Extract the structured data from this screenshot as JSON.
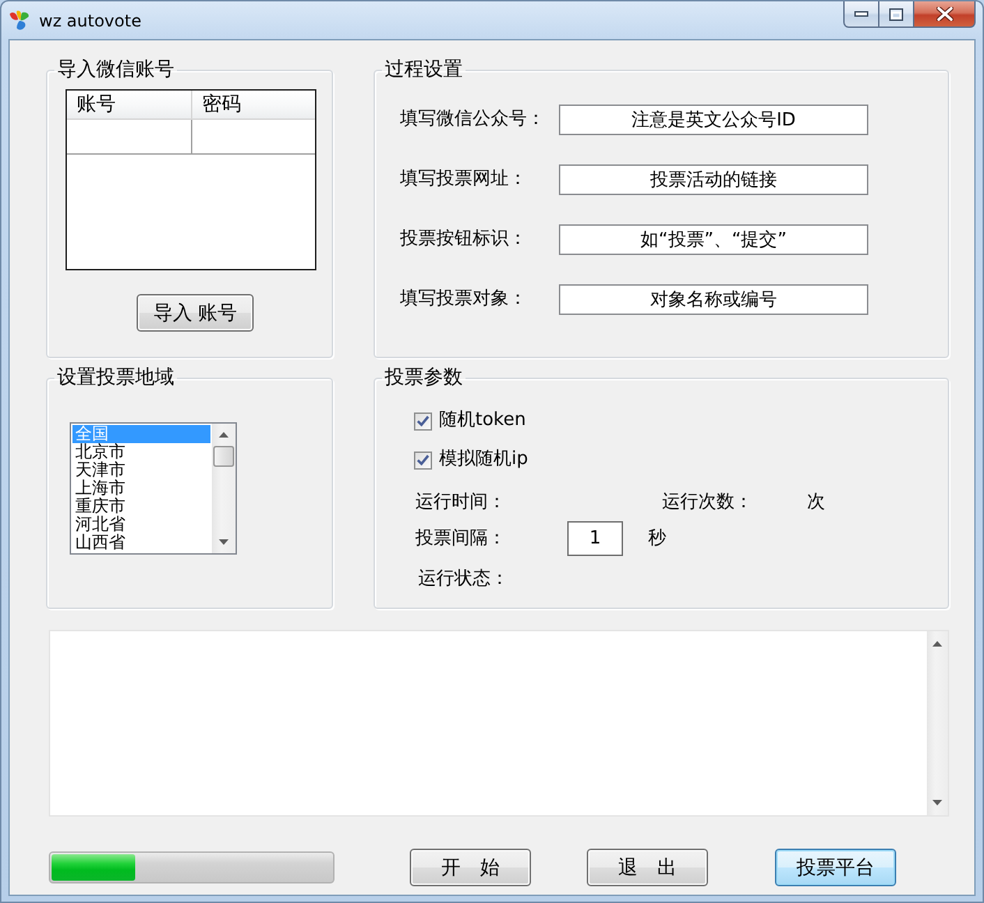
{
  "window": {
    "title": "wz autovote"
  },
  "account_group": {
    "title": "导入微信账号",
    "table": {
      "columns": [
        "账号",
        "密码"
      ]
    },
    "import_button": "导入 账号"
  },
  "process_group": {
    "title": "过程设置",
    "fields": [
      {
        "label": "填写微信公众号：",
        "value": "注意是英文公众号ID"
      },
      {
        "label": "填写投票网址：",
        "value": "投票活动的链接"
      },
      {
        "label": "投票按钮标识：",
        "value": "如“投票”、“提交”"
      },
      {
        "label": "填写投票对象：",
        "value": "对象名称或编号"
      }
    ]
  },
  "region_group": {
    "title": "设置投票地域",
    "list": {
      "items": [
        {
          "label": "全国",
          "selected": true
        },
        {
          "label": "北京市",
          "selected": false
        },
        {
          "label": "天津市",
          "selected": false
        },
        {
          "label": "上海市",
          "selected": false
        },
        {
          "label": "重庆市",
          "selected": false
        },
        {
          "label": "河北省",
          "selected": false
        },
        {
          "label": "山西省",
          "selected": false
        }
      ]
    }
  },
  "params_group": {
    "title": "投票参数",
    "checkboxes": [
      {
        "label": "随机token",
        "checked": true
      },
      {
        "label": "模拟随机ip",
        "checked": true
      }
    ],
    "run_time_label": "运行时间：",
    "run_count_label": "运行次数：",
    "run_count_unit": "次",
    "interval_label": "投票间隔：",
    "interval_value": "1",
    "interval_unit": "秒",
    "status_label": "运行状态："
  },
  "progress": {
    "level": 0.3
  },
  "buttons": [
    {
      "label": "开　始",
      "focused": false
    },
    {
      "label": "退　出",
      "focused": false
    },
    {
      "label": "投票平台",
      "focused": true
    }
  ]
}
